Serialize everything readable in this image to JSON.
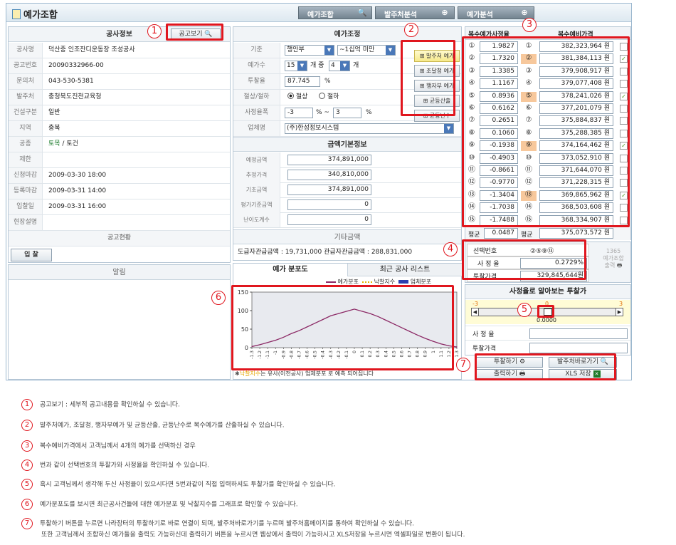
{
  "app": {
    "title": "예가조합"
  },
  "tabs": [
    {
      "label": "예가조합",
      "icon": "search-doc-icon"
    },
    {
      "label": "발주처분석",
      "icon": "plus-icon"
    },
    {
      "label": "예가분석",
      "icon": "plus-icon"
    }
  ],
  "project": {
    "header": "공사정보",
    "notice_button": "공고보기",
    "rows": [
      {
        "label": "공사명",
        "value": "덕산중 인조잔디운동장 조성공사"
      },
      {
        "label": "공고번호",
        "value": "20090332966-00"
      },
      {
        "label": "문의처",
        "value": "043-530-5381"
      },
      {
        "label": "발주처",
        "value": "충청북도진천교육청"
      },
      {
        "label": "건설구분",
        "value": "일반"
      },
      {
        "label": "지역",
        "value": "충북"
      },
      {
        "label": "공종",
        "value": "토목 / 토건",
        "link": "토목",
        "rest": " / 토건"
      },
      {
        "label": "제한",
        "value": ""
      },
      {
        "label": "신청마감",
        "value": "2009-03-30 18:00"
      },
      {
        "label": "등록마감",
        "value": "2009-03-31 14:00"
      },
      {
        "label": "입찰일",
        "value": "2009-03-31 16:00"
      },
      {
        "label": "현장설명",
        "value": ""
      }
    ],
    "status_header": "공고현황",
    "bid_button": "입 찰",
    "alert_header": "알림"
  },
  "adjust": {
    "header": "예가조정",
    "basis_label": "기준",
    "basis_select": "행안부",
    "basis_range": "~1십억 미만",
    "count_label": "예가수",
    "count_a": "15",
    "count_mid": "개 중",
    "count_b": "4",
    "count_unit": "개",
    "rate_label": "투찰율",
    "rate_value": "87.745",
    "rate_unit": "%",
    "cut_label": "절상/절하",
    "cut_up": "절상",
    "cut_down": "절하",
    "range_label": "사정율폭",
    "range_from": "-3",
    "range_to": "3",
    "range_unit1": "% ~",
    "range_unit2": "%",
    "company_label": "업체명",
    "company_value": "(주)한성정보시스템",
    "side_buttons": [
      "발주처 예가",
      "조달청 예가",
      "행자부 예가",
      "균등산출",
      "균등난수"
    ],
    "amount_header": "금액기본정보",
    "amount_rows": [
      {
        "label": "예정금액",
        "value": "374,891,000"
      },
      {
        "label": "추정가격",
        "value": "340,810,000"
      },
      {
        "label": "기초금액",
        "value": "374,891,000"
      },
      {
        "label": "평가기준금액",
        "value": "0"
      },
      {
        "label": "난이도계수",
        "value": "0"
      }
    ],
    "other_header": "기타금액",
    "other_text": "도급자관급금액 : 19,731,000   관급자관급금액 : 288,831,000"
  },
  "chart_tabs": {
    "active": "예가 분포도",
    "other": "최근 공사 리스트"
  },
  "chart_data": {
    "type": "line",
    "legend": [
      "예가분포",
      "낙찰지수",
      "업체분포"
    ],
    "colors": {
      "price": "#8c2a66",
      "index": "#e6b600",
      "company": "#2c3fb0"
    },
    "ylim": [
      0,
      150
    ],
    "yticks": [
      0,
      50,
      100,
      150
    ],
    "x": [
      -1.3,
      -1.2,
      -1.1,
      -1.0,
      -0.9,
      -0.8,
      -0.7,
      -0.6,
      -0.5,
      -0.4,
      -0.3,
      -0.2,
      -0.1,
      0,
      0.1,
      0.2,
      0.3,
      0.4,
      0.5,
      0.6,
      0.7,
      0.8,
      0.9,
      1.0,
      1.1,
      1.2,
      1.3
    ],
    "xtick_labels": [
      "-1.3",
      "-1.2",
      "-1.1",
      "-1",
      "-0.9",
      "-0.8",
      "-0.7",
      "-0.6",
      "-0.5",
      "-0.4",
      "-0.3",
      "-0.2",
      "-0.1",
      "0",
      "0.1",
      "0.2",
      "0.3",
      "0.4",
      "0.5",
      "0.6",
      "0.7",
      "0.8",
      "0.9",
      "1",
      "1.1",
      "1.2",
      "1.3"
    ],
    "series": [
      {
        "name": "예가분포",
        "values": [
          3,
          8,
          14,
          20,
          28,
          38,
          46,
          56,
          66,
          76,
          86,
          92,
          98,
          104,
          98,
          92,
          84,
          74,
          64,
          54,
          44,
          34,
          25,
          17,
          10,
          5,
          2
        ]
      }
    ],
    "footnote_mark": "✱",
    "footnote_key": "낙찰지수",
    "footnote_text": "는 유사(이전공사) 업체분포 로 예측 되어집니다"
  },
  "prices": {
    "header_rate": "복수예가사정율",
    "header_price": "복수예비가격",
    "rows": [
      {
        "n": "①",
        "rate": "1.9827",
        "price": "382,323,964 원",
        "hl": false
      },
      {
        "n": "②",
        "rate": "1.7320",
        "price": "381,384,113 원",
        "hl": true
      },
      {
        "n": "③",
        "rate": "1.3385",
        "price": "379,908,917 원",
        "hl": false
      },
      {
        "n": "④",
        "rate": "1.1167",
        "price": "379,077,408 원",
        "hl": false
      },
      {
        "n": "⑤",
        "rate": "0.8936",
        "price": "378,241,026 원",
        "hl": true
      },
      {
        "n": "⑥",
        "rate": "0.6162",
        "price": "377,201,079 원",
        "hl": false
      },
      {
        "n": "⑦",
        "rate": "0.2651",
        "price": "375,884,837 원",
        "hl": false
      },
      {
        "n": "⑧",
        "rate": "0.1060",
        "price": "375,288,385 원",
        "hl": false
      },
      {
        "n": "⑨",
        "rate": "-0.1938",
        "price": "374,164,462 원",
        "hl": true
      },
      {
        "n": "⑩",
        "rate": "-0.4903",
        "price": "373,052,910 원",
        "hl": false
      },
      {
        "n": "⑪",
        "rate": "-0.8661",
        "price": "371,644,070 원",
        "hl": false
      },
      {
        "n": "⑫",
        "rate": "-0.9770",
        "price": "371,228,315 원",
        "hl": false
      },
      {
        "n": "⑬",
        "rate": "-1.3404",
        "price": "369,865,962 원",
        "hl": true
      },
      {
        "n": "⑭",
        "rate": "-1.7038",
        "price": "368,503,608 원",
        "hl": false
      },
      {
        "n": "⑮",
        "rate": "-1.7488",
        "price": "368,334,907 원",
        "hl": false
      }
    ],
    "avg_label": "평균",
    "avg_rate": "0.0487",
    "avg_price_label": "평균",
    "avg_price": "375,073,572 원"
  },
  "selection": {
    "no_label": "선택번호",
    "no_value": "②⑤⑨⑬",
    "rate_label": "사 정 율",
    "rate_value": "0.2729%",
    "price_label": "투찰가격",
    "price_value": "329,845,644원",
    "side_count": "1365",
    "side_text": "예가조합",
    "side_output": "출력"
  },
  "slider": {
    "header": "사정율로 알아보는 투찰가",
    "min": "-3",
    "mid": "0",
    "max": "3",
    "value": "0.0000",
    "position_fraction": 0.5,
    "rate_label": "사 정 율",
    "price_label": "투찰가격"
  },
  "actions": {
    "bid": "투찰하기",
    "go_client": "발주처바로가기",
    "print": "출력하기",
    "xls": "XLS 저장"
  },
  "callouts": [
    "1",
    "2",
    "3",
    "4",
    "5",
    "6",
    "7"
  ],
  "descriptions": [
    {
      "n": "1",
      "text": "공고보기 : 세부적 공고내용을 확인하실 수 있습니다."
    },
    {
      "n": "2",
      "text": "발주처예가, 조달청, 행자부예가 및 균등산출, 균등난수로 복수예가를 산출하실 수 있습니다."
    },
    {
      "n": "3",
      "text": "복수예비가격에서 고객님께서 4개의 예가를 선택하신 경우"
    },
    {
      "n": "4",
      "text": "번과 같이 선택번호의 투찰가와 사정율을 확인하실 수 있습니다."
    },
    {
      "n": "5",
      "text": "혹시 고객님께서 생각해 두신 사정율이 있으시다면 5번과같이 직접 입력하셔도 투찰가를 확인하실 수 있습니다."
    },
    {
      "n": "6",
      "text": "예가분포도를 보시면 최근공사건들에 대한 예가분포 및 낙찰지수를 그래프로 확인할 수 있습니다."
    },
    {
      "n": "7",
      "text": "투찰하기 버튼을 누르면 나라장터의 투찰하기로 바로 연결이 되며, 발주처바로가기를 누르며 발주처홈페이지를 통하여 확인하실 수 있습니다.",
      "text2": "또한 고객님께서 조합하신 예가들을 출력도 가능하신데 출력하기 버튼을 누르시면 웹상에서 출력이 가능하시고 XLS저장을 누르시면 엑셀파일로 변환이 됩니다."
    }
  ]
}
